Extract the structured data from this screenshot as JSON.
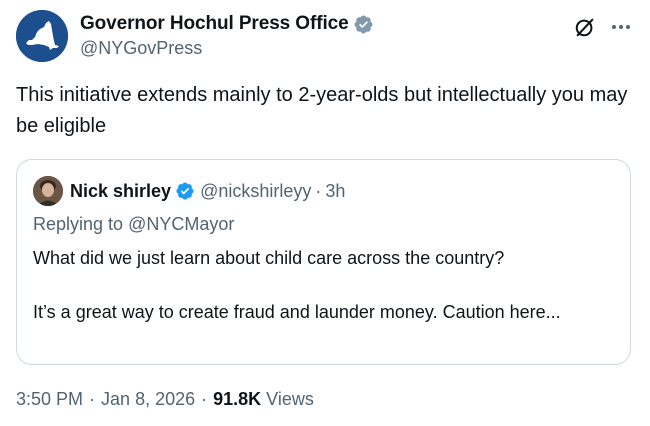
{
  "author": {
    "display_name": "Governor Hochul Press Office",
    "handle": "@NYGovPress",
    "avatar_icon": "new-york-state-map-icon",
    "verified_badge": "verified-gray-badge-icon",
    "verified_color": "#829aab",
    "avatar_bg": "#1d4f8f"
  },
  "actions": {
    "grok_icon": "grok-icon",
    "more_icon": "more-icon"
  },
  "tweet": {
    "text": "This initiative extends mainly to 2-year-olds but intellectually you may be eligible"
  },
  "quoted_tweet": {
    "display_name": "Nick shirley",
    "handle": "@nickshirleyy",
    "separator": "·",
    "time": "3h",
    "verified_badge": "verified-blue-badge-icon",
    "verified_color": "#1d9bf0",
    "reply_prefix": "Replying to",
    "reply_to": "@NYCMayor",
    "paragraphs": [
      "What did we just learn about child care across the country?",
      "It’s a great way to create fraud and launder money. Caution here..."
    ]
  },
  "meta": {
    "time": "3:50 PM",
    "separator": "·",
    "date": "Jan 8, 2026",
    "views_count": "91.8K",
    "views_label": "Views"
  },
  "colors": {
    "text_primary": "#0f1419",
    "text_secondary": "#536471",
    "border": "#cfd9de"
  }
}
